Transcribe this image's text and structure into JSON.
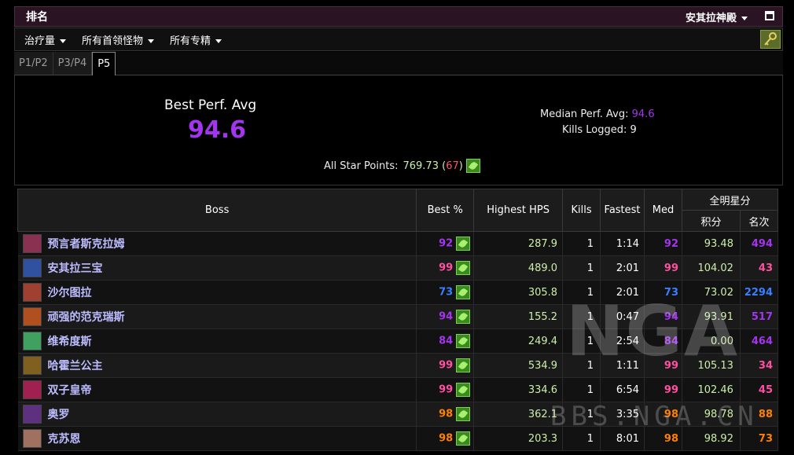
{
  "titlebar": {
    "title": "排名",
    "realm": "安其拉神殿"
  },
  "filters": [
    "治疗量",
    "所有首领怪物",
    "所有专精"
  ],
  "tabs": [
    {
      "label": "P1/P2",
      "active": false
    },
    {
      "label": "P3/P4",
      "active": false
    },
    {
      "label": "P5",
      "active": true
    }
  ],
  "summary": {
    "best_label": "Best Perf. Avg",
    "best_value": "94.6",
    "median_label": "Median Perf. Avg:",
    "median_value": "94.6",
    "kills_label": "Kills Logged:",
    "kills_value": "9",
    "star_label": "All Star Points:",
    "star_value": "769.73",
    "star_rank": "67"
  },
  "table": {
    "headers": {
      "boss": "Boss",
      "best": "Best %",
      "hps": "Highest HPS",
      "kills": "Kills",
      "fastest": "Fastest",
      "med": "Med",
      "allstar": "全明星分",
      "points": "积分",
      "rank": "名次"
    },
    "rows": [
      {
        "boss": "预言者斯克拉姆",
        "best": "92",
        "best_color": "#a335ee",
        "hps": "287.9",
        "kills": "1",
        "fastest": "1:14",
        "med": "92",
        "med_color": "#a335ee",
        "points": "93.48",
        "rank": "494",
        "rank_color": "#a335ee",
        "icon_color": "#8a3050"
      },
      {
        "boss": "安其拉三宝",
        "best": "99",
        "best_color": "#ff4fa0",
        "hps": "489.0",
        "kills": "1",
        "fastest": "2:01",
        "med": "99",
        "med_color": "#ff4fa0",
        "points": "104.02",
        "rank": "43",
        "rank_color": "#ff4fa0",
        "icon_color": "#3050a0"
      },
      {
        "boss": "沙尔图拉",
        "best": "73",
        "best_color": "#3a7fff",
        "hps": "305.8",
        "kills": "1",
        "fastest": "2:01",
        "med": "73",
        "med_color": "#3a7fff",
        "points": "73.02",
        "rank": "2294",
        "rank_color": "#3a7fff",
        "icon_color": "#a04030"
      },
      {
        "boss": "顽强的范克瑞斯",
        "best": "94",
        "best_color": "#a335ee",
        "hps": "155.2",
        "kills": "1",
        "fastest": "0:47",
        "med": "94",
        "med_color": "#a335ee",
        "points": "93.91",
        "rank": "517",
        "rank_color": "#a335ee",
        "icon_color": "#b05020"
      },
      {
        "boss": "维希度斯",
        "best": "84",
        "best_color": "#a335ee",
        "hps": "249.4",
        "kills": "1",
        "fastest": "2:54",
        "med": "84",
        "med_color": "#a335ee",
        "points": "0.00",
        "rank": "464",
        "rank_color": "#a335ee",
        "icon_color": "#40a060"
      },
      {
        "boss": "哈霍兰公主",
        "best": "99",
        "best_color": "#ff4fa0",
        "hps": "534.9",
        "kills": "1",
        "fastest": "1:11",
        "med": "99",
        "med_color": "#ff4fa0",
        "points": "105.13",
        "rank": "34",
        "rank_color": "#ff4fa0",
        "icon_color": "#806020"
      },
      {
        "boss": "双子皇帝",
        "best": "99",
        "best_color": "#ff4fa0",
        "hps": "334.6",
        "kills": "1",
        "fastest": "6:54",
        "med": "99",
        "med_color": "#ff4fa0",
        "points": "102.46",
        "rank": "45",
        "rank_color": "#ff4fa0",
        "icon_color": "#a02050"
      },
      {
        "boss": "奥罗",
        "best": "98",
        "best_color": "#ff8000",
        "hps": "362.1",
        "kills": "1",
        "fastest": "3:35",
        "med": "98",
        "med_color": "#ff8000",
        "points": "98.78",
        "rank": "88",
        "rank_color": "#ff8000",
        "icon_color": "#603080"
      },
      {
        "boss": "克苏恩",
        "best": "98",
        "best_color": "#ff8000",
        "hps": "203.3",
        "kills": "1",
        "fastest": "8:01",
        "med": "98",
        "med_color": "#ff8000",
        "points": "98.92",
        "rank": "73",
        "rank_color": "#ff8000",
        "icon_color": "#a07060"
      }
    ]
  },
  "watermark": {
    "text": "NGA",
    "url": "BBS.NGA.CN"
  }
}
